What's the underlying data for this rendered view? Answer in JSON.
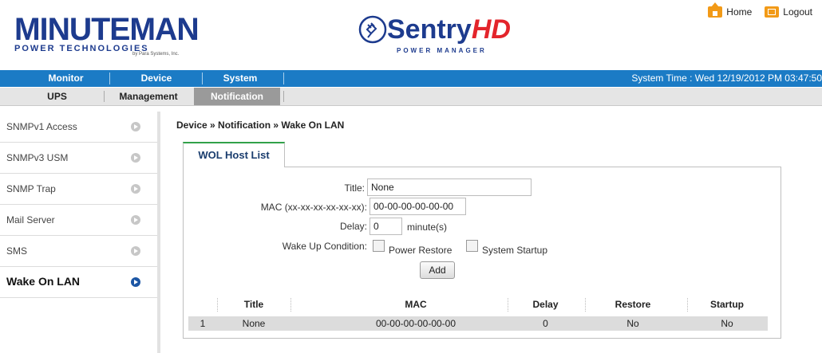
{
  "header": {
    "brand_main": "MINUTEMAN",
    "brand_sub": "POWER TECHNOLOGIES",
    "brand_tiny": "by Para Systems, Inc.",
    "product_main": "Sentry",
    "product_hd": "HD",
    "product_sub": "POWER MANAGER",
    "links": [
      {
        "label": "Home",
        "icon": "home-icon"
      },
      {
        "label": "Logout",
        "icon": "logout-icon"
      }
    ]
  },
  "nav": {
    "items": [
      "Monitor",
      "Device",
      "System"
    ],
    "active": "Device",
    "system_time": "System Time : Wed 12/19/2012 PM 03:47:50"
  },
  "subnav": {
    "items": [
      "UPS",
      "Management",
      "Notification"
    ],
    "active": "Notification"
  },
  "sidebar": {
    "items": [
      {
        "label": "SNMPv1 Access"
      },
      {
        "label": "SNMPv3 USM"
      },
      {
        "label": "SNMP Trap"
      },
      {
        "label": "Mail Server"
      },
      {
        "label": "SMS"
      },
      {
        "label": "Wake On LAN"
      }
    ],
    "active": "Wake On LAN"
  },
  "main": {
    "breadcrumb": "Device » Notification » Wake On LAN",
    "tab_label": "WOL Host List",
    "form": {
      "title_label": "Title:",
      "title_value": "None",
      "mac_label": "MAC (xx-xx-xx-xx-xx-xx):",
      "mac_value": "00-00-00-00-00-00",
      "delay_label": "Delay:",
      "delay_value": "0",
      "delay_unit": "minute(s)",
      "wake_label": "Wake Up Condition:",
      "power_restore_label": "Power Restore",
      "system_startup_label": "System Startup",
      "add_label": "Add"
    },
    "table": {
      "columns": [
        "",
        "Title",
        "MAC",
        "Delay",
        "Restore",
        "Startup"
      ],
      "rows": [
        [
          "1",
          "None",
          "00-00-00-00-00-00",
          "0",
          "No",
          "No"
        ]
      ]
    }
  },
  "colors": {
    "nav_blue": "#1b7bc5",
    "brand_blue": "#1d3b8e",
    "brand_red": "#e3242b",
    "tab_green": "#32a14a",
    "icon_orange": "#f29a17"
  }
}
